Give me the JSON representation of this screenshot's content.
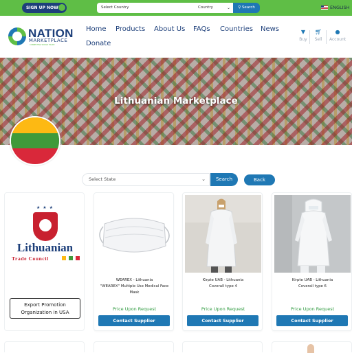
{
  "topbar": {
    "signup_label": "SIGN UP NOW!",
    "country_placeholder": "Select Country",
    "country_mid_label": "Country",
    "search_label": "Search",
    "language_label": "ENGLISH"
  },
  "brand": {
    "name": "NATION",
    "sub": "MARKETPLACE",
    "tagline": "CONNECTING WORLD TRADE"
  },
  "nav": {
    "items": [
      "Home",
      "Products",
      "About Us",
      "FAQs",
      "Countries",
      "News",
      "Donate"
    ]
  },
  "header_actions": [
    {
      "label": "Buy",
      "icon": "cart-down-icon"
    },
    {
      "label": "Sell",
      "icon": "cart-icon"
    },
    {
      "label": "Account",
      "icon": "user-icon"
    }
  ],
  "banner": {
    "title": "Lithuanian Marketplace",
    "flag_colors": [
      "#fdb913",
      "#3f9a3a",
      "#d9283a"
    ]
  },
  "filter": {
    "state_placeholder": "Select State",
    "search_label": "Search",
    "back_label": "Back"
  },
  "council_card": {
    "name": "Lithuanian",
    "sub": "Trade Council",
    "button_label": "Export Promotion Organization in USA"
  },
  "products": [
    {
      "seller": "WEAREX - Lithuania",
      "name": "\"WEAREX\" Multiple Use Medical Face Mask",
      "price": "Price Upon Request",
      "cta": "Contact Supplier"
    },
    {
      "seller": "Kirpte UAB - Lithuania",
      "name": "Coverall type 4",
      "price": "Price Upon Request",
      "cta": "Contact Supplier"
    },
    {
      "seller": "Kirpte UAB - Lithuania",
      "name": "Coverall type 6",
      "price": "Price Upon Request",
      "cta": "Contact Supplier"
    }
  ],
  "colors": {
    "green": "#5fbe46",
    "navy": "#1d3f7a",
    "blue": "#1f78b4",
    "price_green": "#2e9a3f"
  }
}
